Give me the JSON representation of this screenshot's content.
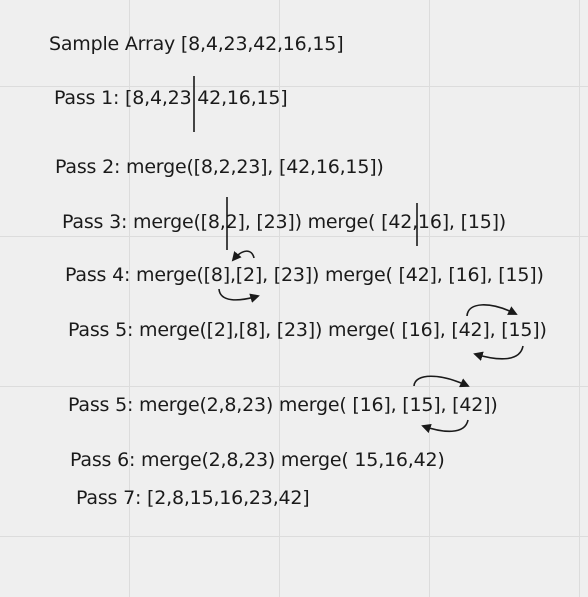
{
  "lines": {
    "sample": "Sample Array [8,4,23,42,16,15]",
    "pass1": "Pass 1: [8,4,23 42,16,15]",
    "pass2": "Pass 2: merge([8,2,23], [42,16,15])",
    "pass3": "Pass 3: merge([8,2], [23]) merge( [42,16], [15])",
    "pass4": "Pass 4: merge([8],[2], [23]) merge( [42], [16], [15])",
    "pass5a": "Pass 5: merge([2],[8], [23]) merge( [16], [42], [15])",
    "pass5b": "Pass 5: merge(2,8,23) merge( [16], [15], [42])",
    "pass6": "Pass 6: merge(2,8,23) merge( 15,16,42)",
    "pass7": "Pass 7: [2,8,15,16,23,42]"
  },
  "colors": {
    "background": "#efefef",
    "grid": "#dcdcdc",
    "ink": "#1a1a1a"
  }
}
